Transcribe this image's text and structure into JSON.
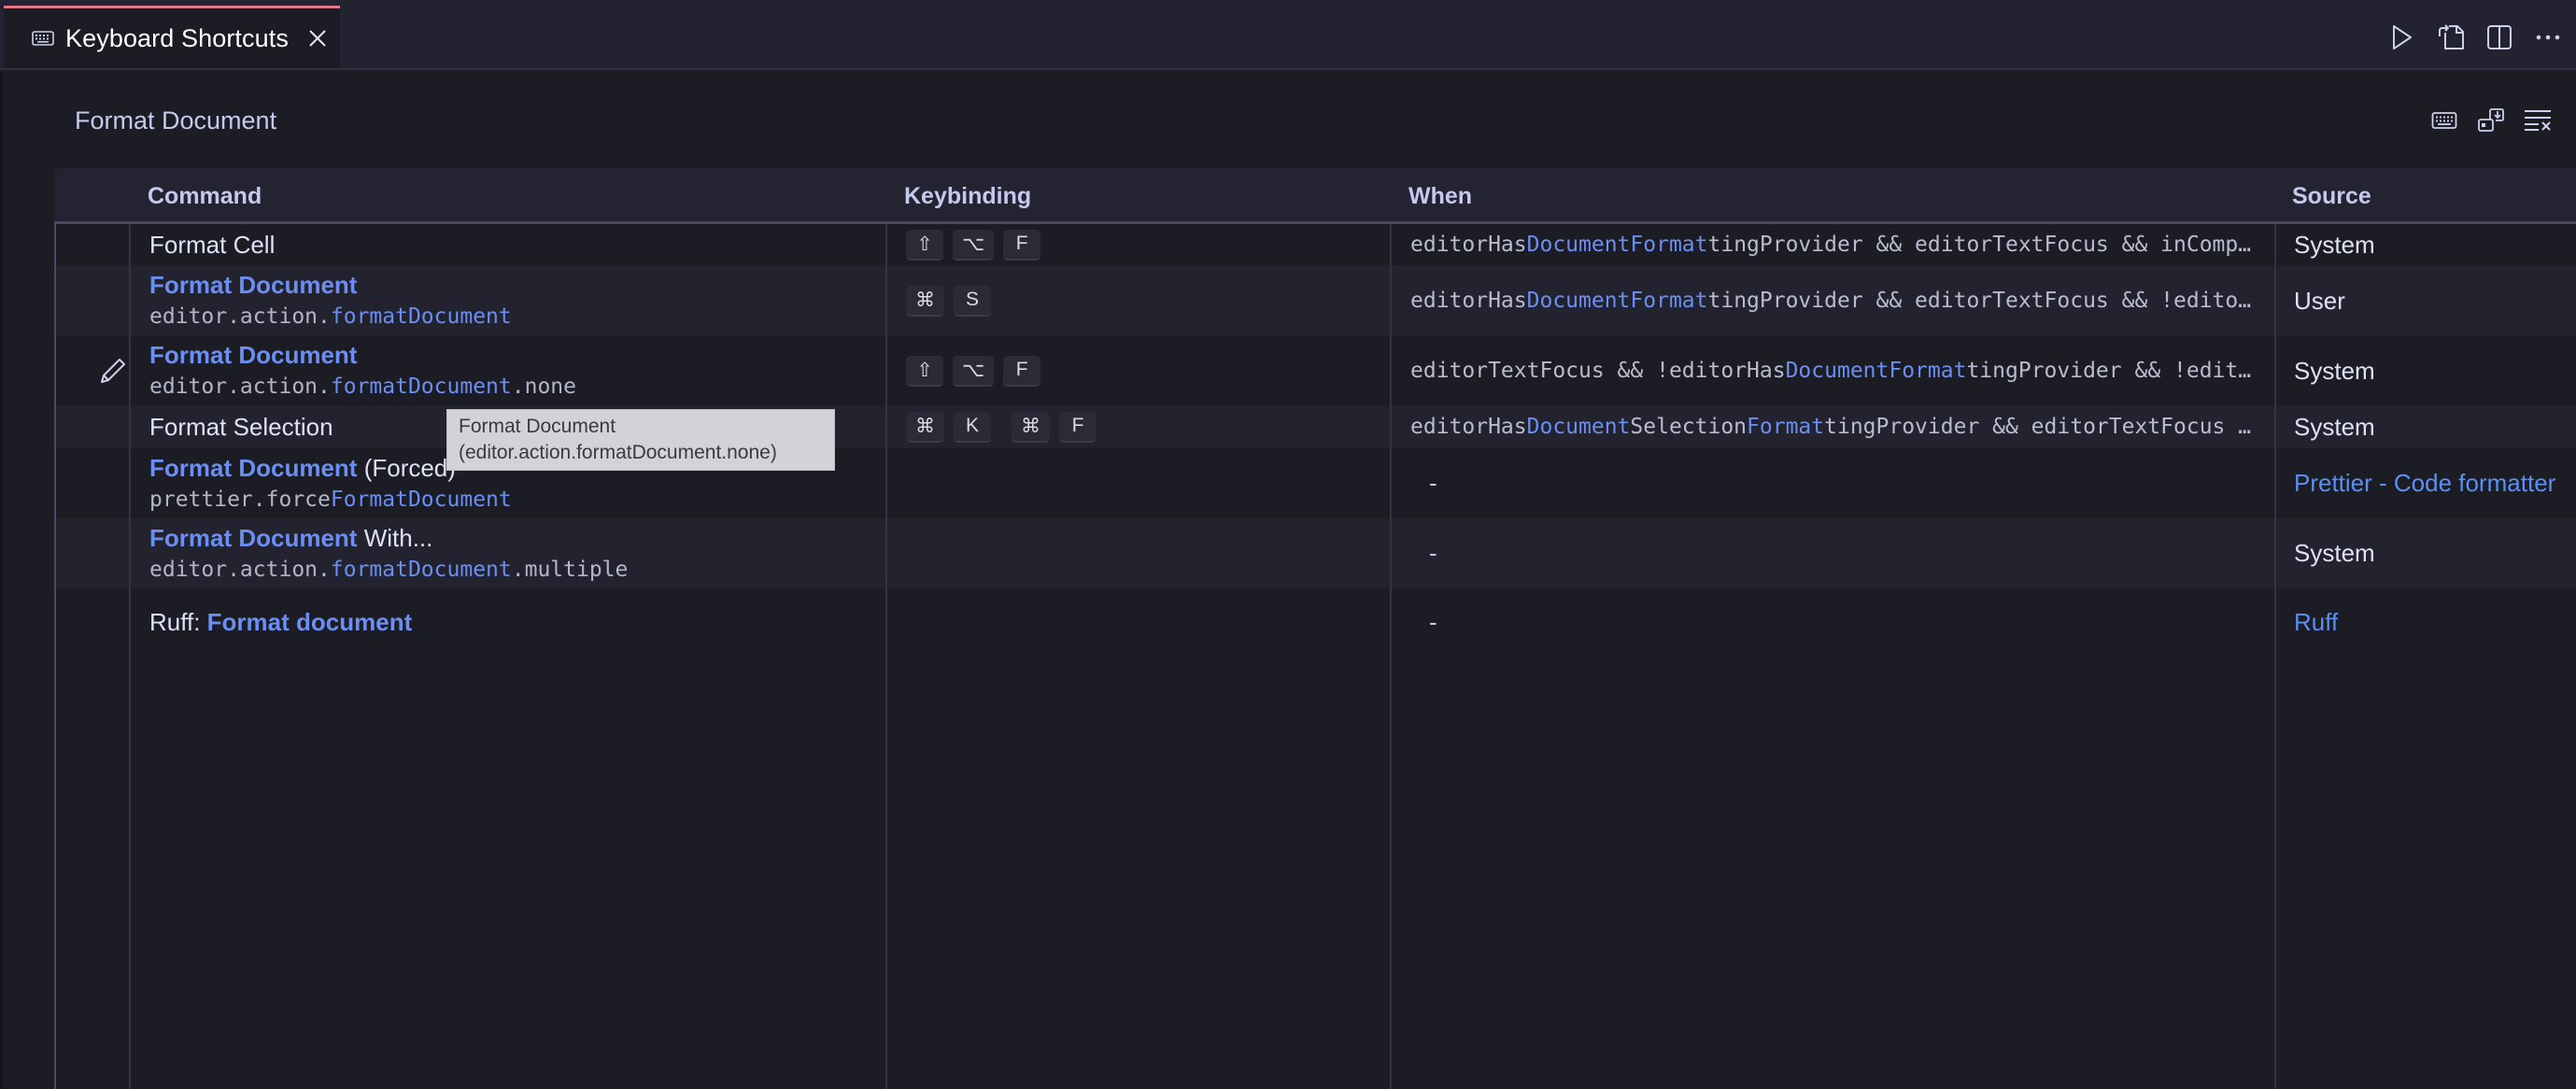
{
  "tab": {
    "icon": "keyboard-icon",
    "title": "Keyboard Shortcuts",
    "close_icon": "close-icon",
    "accent_color": "#e0788a"
  },
  "editor_actions": [
    {
      "name": "run-icon",
      "label": "Run"
    },
    {
      "name": "open-json-icon",
      "label": "Open Keyboard Shortcuts (JSON)"
    },
    {
      "name": "split-editor-icon",
      "label": "Split Editor"
    },
    {
      "name": "more-actions-icon",
      "label": "More Actions..."
    }
  ],
  "search": {
    "value": "Format Document",
    "actions": [
      {
        "name": "record-keys-icon",
        "label": "Record Keys"
      },
      {
        "name": "sort-by-precedence-icon",
        "label": "Sort by Precedence"
      },
      {
        "name": "clear-search-icon",
        "label": "Clear Keybindings Search Input"
      }
    ]
  },
  "table": {
    "headers": {
      "command": "Command",
      "keybinding": "Keybinding",
      "when": "When",
      "source": "Source"
    },
    "rows": [
      {
        "edit_icon": false,
        "title_parts": [
          {
            "text": "Format Cell",
            "hl": false
          }
        ],
        "id_parts": [],
        "keys": [
          [
            "⇧",
            "⌥",
            "F"
          ]
        ],
        "when_parts": [
          {
            "text": "editorHas",
            "hl": false
          },
          {
            "text": "DocumentFormat",
            "hl": true
          },
          {
            "text": "tingProvider && editorTextFocus && inComp…",
            "hl": false
          }
        ],
        "source": "System",
        "source_link": false
      },
      {
        "edit_icon": false,
        "title_parts": [
          {
            "text": "Format Document",
            "hl": true
          }
        ],
        "id_parts": [
          {
            "text": "editor.action.",
            "hl": false
          },
          {
            "text": "formatDocument",
            "hl": true
          }
        ],
        "keys": [
          [
            "⌘",
            "S"
          ]
        ],
        "when_parts": [
          {
            "text": "editorHas",
            "hl": false
          },
          {
            "text": "DocumentFormat",
            "hl": true
          },
          {
            "text": "tingProvider && editorTextFocus && !edito…",
            "hl": false
          }
        ],
        "source": "User",
        "source_link": false
      },
      {
        "edit_icon": true,
        "title_parts": [
          {
            "text": "Format Document",
            "hl": true
          }
        ],
        "id_parts": [
          {
            "text": "editor.action.",
            "hl": false
          },
          {
            "text": "formatDocument",
            "hl": true
          },
          {
            "text": ".none",
            "hl": false
          }
        ],
        "keys": [
          [
            "⇧",
            "⌥",
            "F"
          ]
        ],
        "when_parts": [
          {
            "text": "editorTextFocus && !editorHas",
            "hl": false
          },
          {
            "text": "DocumentFormat",
            "hl": true
          },
          {
            "text": "tingProvider && !edit…",
            "hl": false
          }
        ],
        "source": "System",
        "source_link": false
      },
      {
        "edit_icon": false,
        "title_parts": [
          {
            "text": "Format Selection",
            "hl": false
          }
        ],
        "id_parts": [],
        "keys": [
          [
            "⌘",
            "K"
          ],
          [
            "⌘",
            "F"
          ]
        ],
        "when_parts": [
          {
            "text": "editorHas",
            "hl": false
          },
          {
            "text": "Document",
            "hl": true
          },
          {
            "text": "Selection",
            "hl": false
          },
          {
            "text": "Format",
            "hl": true
          },
          {
            "text": "tingProvider && editorTextFocus …",
            "hl": false
          }
        ],
        "source": "System",
        "source_link": false
      },
      {
        "edit_icon": false,
        "title_parts": [
          {
            "text": "Format Document",
            "hl": true
          },
          {
            "text": " (Forced)",
            "hl": false
          }
        ],
        "id_parts": [
          {
            "text": "prettier.force",
            "hl": false
          },
          {
            "text": "FormatDocument",
            "hl": true
          }
        ],
        "keys": [],
        "when_parts": [
          {
            "text": "-",
            "hl": false
          }
        ],
        "when_dash": true,
        "source": "Prettier - Code formatter",
        "source_link": true
      },
      {
        "edit_icon": false,
        "title_parts": [
          {
            "text": "Format Document",
            "hl": true
          },
          {
            "text": " With...",
            "hl": false
          }
        ],
        "id_parts": [
          {
            "text": "editor.action.",
            "hl": false
          },
          {
            "text": "formatDocument",
            "hl": true
          },
          {
            "text": ".multiple",
            "hl": false
          }
        ],
        "keys": [],
        "when_parts": [
          {
            "text": "-",
            "hl": false
          }
        ],
        "when_dash": true,
        "source": "System",
        "source_link": false
      },
      {
        "edit_icon": false,
        "title_parts": [
          {
            "text": "Ruff: ",
            "hl": false
          },
          {
            "text": "Format document",
            "hl": true
          }
        ],
        "id_parts": [],
        "keys": [],
        "when_parts": [
          {
            "text": "-",
            "hl": false
          }
        ],
        "when_dash": true,
        "source": "Ruff",
        "source_link": true
      }
    ]
  },
  "tooltip": {
    "line1": "Format Document",
    "line2": "(editor.action.formatDocument.none)"
  },
  "colors": {
    "highlight": "#6b8ef0",
    "link": "#5b8ff0",
    "tab_accent": "#e0788a"
  }
}
